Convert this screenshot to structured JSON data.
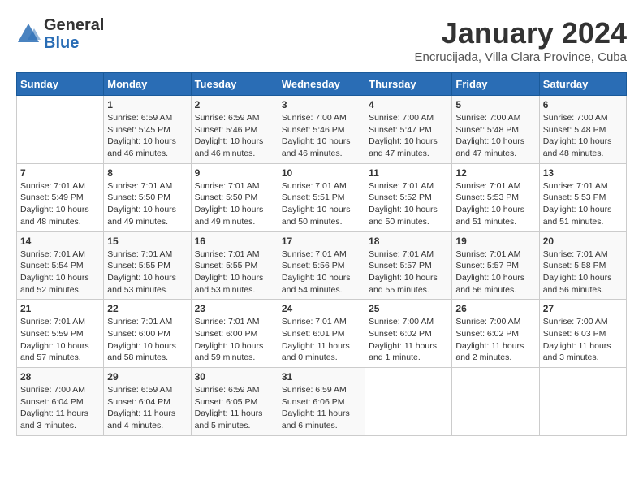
{
  "header": {
    "logo_general": "General",
    "logo_blue": "Blue",
    "month_title": "January 2024",
    "location": "Encrucijada, Villa Clara Province, Cuba"
  },
  "days_of_week": [
    "Sunday",
    "Monday",
    "Tuesday",
    "Wednesday",
    "Thursday",
    "Friday",
    "Saturday"
  ],
  "weeks": [
    [
      {
        "day": "",
        "sunrise": "",
        "sunset": "",
        "daylight": ""
      },
      {
        "day": "1",
        "sunrise": "Sunrise: 6:59 AM",
        "sunset": "Sunset: 5:45 PM",
        "daylight": "Daylight: 10 hours and 46 minutes."
      },
      {
        "day": "2",
        "sunrise": "Sunrise: 6:59 AM",
        "sunset": "Sunset: 5:46 PM",
        "daylight": "Daylight: 10 hours and 46 minutes."
      },
      {
        "day": "3",
        "sunrise": "Sunrise: 7:00 AM",
        "sunset": "Sunset: 5:46 PM",
        "daylight": "Daylight: 10 hours and 46 minutes."
      },
      {
        "day": "4",
        "sunrise": "Sunrise: 7:00 AM",
        "sunset": "Sunset: 5:47 PM",
        "daylight": "Daylight: 10 hours and 47 minutes."
      },
      {
        "day": "5",
        "sunrise": "Sunrise: 7:00 AM",
        "sunset": "Sunset: 5:48 PM",
        "daylight": "Daylight: 10 hours and 47 minutes."
      },
      {
        "day": "6",
        "sunrise": "Sunrise: 7:00 AM",
        "sunset": "Sunset: 5:48 PM",
        "daylight": "Daylight: 10 hours and 48 minutes."
      }
    ],
    [
      {
        "day": "7",
        "sunrise": "Sunrise: 7:01 AM",
        "sunset": "Sunset: 5:49 PM",
        "daylight": "Daylight: 10 hours and 48 minutes."
      },
      {
        "day": "8",
        "sunrise": "Sunrise: 7:01 AM",
        "sunset": "Sunset: 5:50 PM",
        "daylight": "Daylight: 10 hours and 49 minutes."
      },
      {
        "day": "9",
        "sunrise": "Sunrise: 7:01 AM",
        "sunset": "Sunset: 5:50 PM",
        "daylight": "Daylight: 10 hours and 49 minutes."
      },
      {
        "day": "10",
        "sunrise": "Sunrise: 7:01 AM",
        "sunset": "Sunset: 5:51 PM",
        "daylight": "Daylight: 10 hours and 50 minutes."
      },
      {
        "day": "11",
        "sunrise": "Sunrise: 7:01 AM",
        "sunset": "Sunset: 5:52 PM",
        "daylight": "Daylight: 10 hours and 50 minutes."
      },
      {
        "day": "12",
        "sunrise": "Sunrise: 7:01 AM",
        "sunset": "Sunset: 5:53 PM",
        "daylight": "Daylight: 10 hours and 51 minutes."
      },
      {
        "day": "13",
        "sunrise": "Sunrise: 7:01 AM",
        "sunset": "Sunset: 5:53 PM",
        "daylight": "Daylight: 10 hours and 51 minutes."
      }
    ],
    [
      {
        "day": "14",
        "sunrise": "Sunrise: 7:01 AM",
        "sunset": "Sunset: 5:54 PM",
        "daylight": "Daylight: 10 hours and 52 minutes."
      },
      {
        "day": "15",
        "sunrise": "Sunrise: 7:01 AM",
        "sunset": "Sunset: 5:55 PM",
        "daylight": "Daylight: 10 hours and 53 minutes."
      },
      {
        "day": "16",
        "sunrise": "Sunrise: 7:01 AM",
        "sunset": "Sunset: 5:55 PM",
        "daylight": "Daylight: 10 hours and 53 minutes."
      },
      {
        "day": "17",
        "sunrise": "Sunrise: 7:01 AM",
        "sunset": "Sunset: 5:56 PM",
        "daylight": "Daylight: 10 hours and 54 minutes."
      },
      {
        "day": "18",
        "sunrise": "Sunrise: 7:01 AM",
        "sunset": "Sunset: 5:57 PM",
        "daylight": "Daylight: 10 hours and 55 minutes."
      },
      {
        "day": "19",
        "sunrise": "Sunrise: 7:01 AM",
        "sunset": "Sunset: 5:57 PM",
        "daylight": "Daylight: 10 hours and 56 minutes."
      },
      {
        "day": "20",
        "sunrise": "Sunrise: 7:01 AM",
        "sunset": "Sunset: 5:58 PM",
        "daylight": "Daylight: 10 hours and 56 minutes."
      }
    ],
    [
      {
        "day": "21",
        "sunrise": "Sunrise: 7:01 AM",
        "sunset": "Sunset: 5:59 PM",
        "daylight": "Daylight: 10 hours and 57 minutes."
      },
      {
        "day": "22",
        "sunrise": "Sunrise: 7:01 AM",
        "sunset": "Sunset: 6:00 PM",
        "daylight": "Daylight: 10 hours and 58 minutes."
      },
      {
        "day": "23",
        "sunrise": "Sunrise: 7:01 AM",
        "sunset": "Sunset: 6:00 PM",
        "daylight": "Daylight: 10 hours and 59 minutes."
      },
      {
        "day": "24",
        "sunrise": "Sunrise: 7:01 AM",
        "sunset": "Sunset: 6:01 PM",
        "daylight": "Daylight: 11 hours and 0 minutes."
      },
      {
        "day": "25",
        "sunrise": "Sunrise: 7:00 AM",
        "sunset": "Sunset: 6:02 PM",
        "daylight": "Daylight: 11 hours and 1 minute."
      },
      {
        "day": "26",
        "sunrise": "Sunrise: 7:00 AM",
        "sunset": "Sunset: 6:02 PM",
        "daylight": "Daylight: 11 hours and 2 minutes."
      },
      {
        "day": "27",
        "sunrise": "Sunrise: 7:00 AM",
        "sunset": "Sunset: 6:03 PM",
        "daylight": "Daylight: 11 hours and 3 minutes."
      }
    ],
    [
      {
        "day": "28",
        "sunrise": "Sunrise: 7:00 AM",
        "sunset": "Sunset: 6:04 PM",
        "daylight": "Daylight: 11 hours and 3 minutes."
      },
      {
        "day": "29",
        "sunrise": "Sunrise: 6:59 AM",
        "sunset": "Sunset: 6:04 PM",
        "daylight": "Daylight: 11 hours and 4 minutes."
      },
      {
        "day": "30",
        "sunrise": "Sunrise: 6:59 AM",
        "sunset": "Sunset: 6:05 PM",
        "daylight": "Daylight: 11 hours and 5 minutes."
      },
      {
        "day": "31",
        "sunrise": "Sunrise: 6:59 AM",
        "sunset": "Sunset: 6:06 PM",
        "daylight": "Daylight: 11 hours and 6 minutes."
      },
      {
        "day": "",
        "sunrise": "",
        "sunset": "",
        "daylight": ""
      },
      {
        "day": "",
        "sunrise": "",
        "sunset": "",
        "daylight": ""
      },
      {
        "day": "",
        "sunrise": "",
        "sunset": "",
        "daylight": ""
      }
    ]
  ]
}
